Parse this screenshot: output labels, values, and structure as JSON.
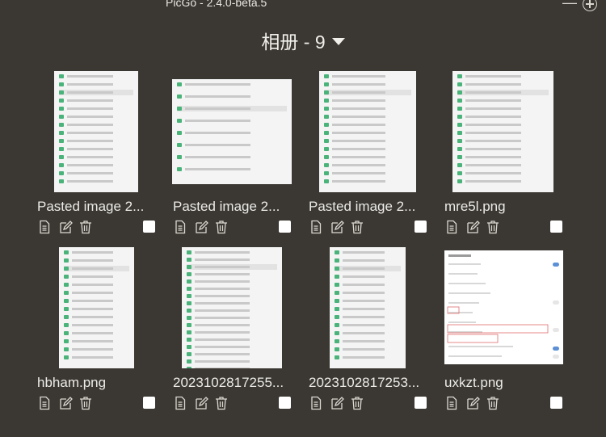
{
  "window": {
    "title": "PicGo - 2.4.0-beta.5"
  },
  "header": {
    "album_label": "相册 - 9"
  },
  "images": [
    {
      "name": "Pasted image 2..."
    },
    {
      "name": "Pasted image 2..."
    },
    {
      "name": "Pasted image 2..."
    },
    {
      "name": "mre5l.png"
    },
    {
      "name": "hbham.png"
    },
    {
      "name": "2023102817255..."
    },
    {
      "name": "2023102817253..."
    },
    {
      "name": "uxkzt.png"
    }
  ],
  "icons": {
    "info": "document-icon",
    "edit": "edit-icon",
    "delete": "trash-icon",
    "select": "checkbox"
  },
  "colors": {
    "background": "#3b3833",
    "text": "#ecebe7",
    "accent": "#49b37a"
  }
}
